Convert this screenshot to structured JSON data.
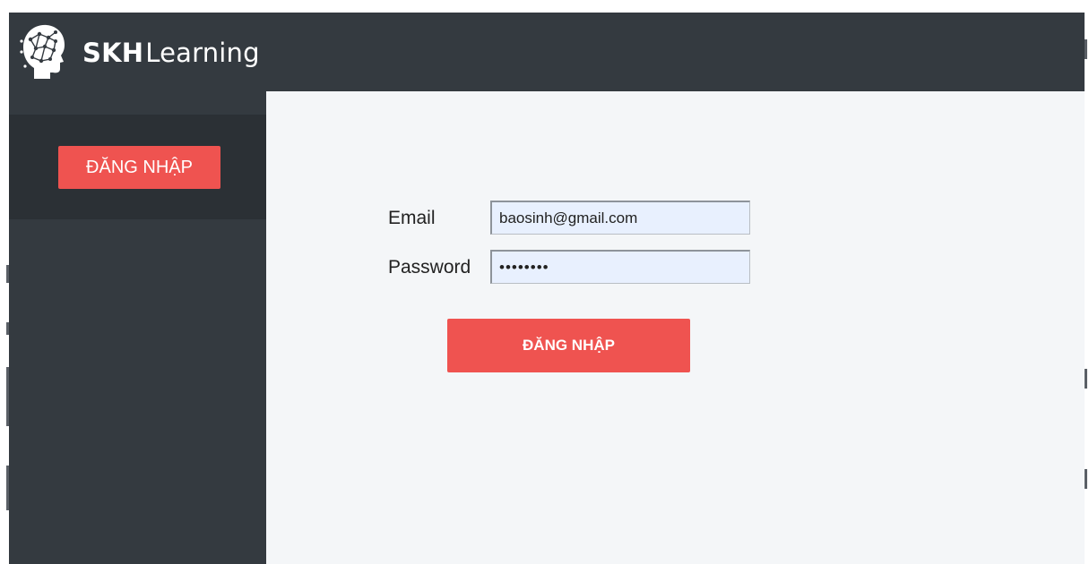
{
  "brand": {
    "name_bold": "SKH",
    "name_light": "Learning",
    "logo_icon": "brain-head-icon"
  },
  "sidebar": {
    "login_button_label": "ĐĂNG NHẬP"
  },
  "login_form": {
    "email_label": "Email",
    "email_value": "baosinh@gmail.com",
    "password_label": "Password",
    "password_value": "••••••••",
    "submit_label": "ĐĂNG NHẬP"
  },
  "colors": {
    "header_bg": "#343a40",
    "sidebar_panel_bg": "#2b3035",
    "content_bg": "#f4f6f8",
    "accent_red": "#ef5350",
    "autofill_input_bg": "#e8f0fe"
  }
}
